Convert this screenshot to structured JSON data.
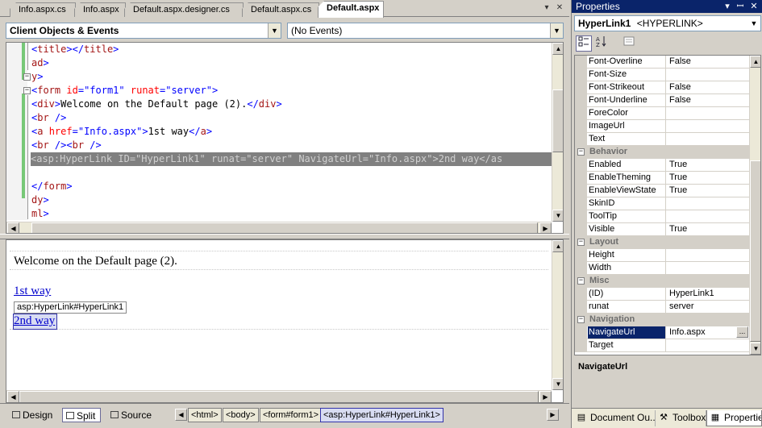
{
  "editor_tabs": [
    "Info.aspx.cs",
    "Info.aspx",
    "Default.aspx.designer.cs",
    "Default.aspx.cs",
    "Default.aspx"
  ],
  "active_tab": "Default.aspx",
  "tab_controls": {
    "dropdown": "▾",
    "close": "✕"
  },
  "client_objects_combo": "Client Objects & Events",
  "events_combo": "(No Events)",
  "code_lines": [
    "<title></title>",
    "ad>",
    "y>",
    "<form id=\"form1\" runat=\"server\">",
    "<div>Welcome on the Default page (2).</div>",
    "<br />",
    "<a href=\"Info.aspx\">1st way</a>",
    "<br /><br />",
    "<asp:HyperLink ID=\"HyperLink1\" runat=\"server\" NavigateUrl=\"Info.aspx\">2nd way</as",
    "",
    "</form>",
    "dy>",
    "ml>"
  ],
  "design": {
    "welcome_text": "Welcome on the Default page (2).",
    "link1": "1st way",
    "selected_tag": "asp:HyperLink#HyperLink1",
    "link2": "2nd way"
  },
  "view_buttons": {
    "design": "Design",
    "split": "Split",
    "source": "Source"
  },
  "breadcrumbs": [
    "<html>",
    "<body>",
    "<form#form1>",
    "<asp:HyperLink#HyperLink1>"
  ],
  "properties": {
    "title": "Properties",
    "title_buttons": {
      "dropdown": "▾",
      "pin": "ꟷ",
      "close": "✕"
    },
    "object_name": "HyperLink1",
    "object_type": "<HYPERLINK>",
    "toolbar_icons": [
      "categorized-icon",
      "alphabetical-icon",
      "property-pages-icon"
    ],
    "rows": [
      {
        "kind": "prop",
        "name": "Font-Overline",
        "value": "False"
      },
      {
        "kind": "prop",
        "name": "Font-Size",
        "value": ""
      },
      {
        "kind": "prop",
        "name": "Font-Strikeout",
        "value": "False"
      },
      {
        "kind": "prop",
        "name": "Font-Underline",
        "value": "False"
      },
      {
        "kind": "prop",
        "name": "ForeColor",
        "value": ""
      },
      {
        "kind": "prop",
        "name": "ImageUrl",
        "value": ""
      },
      {
        "kind": "prop",
        "name": "Text",
        "value": ""
      },
      {
        "kind": "cat",
        "name": "Behavior"
      },
      {
        "kind": "prop",
        "name": "Enabled",
        "value": "True"
      },
      {
        "kind": "prop",
        "name": "EnableTheming",
        "value": "True"
      },
      {
        "kind": "prop",
        "name": "EnableViewState",
        "value": "True"
      },
      {
        "kind": "prop",
        "name": "SkinID",
        "value": ""
      },
      {
        "kind": "prop",
        "name": "ToolTip",
        "value": ""
      },
      {
        "kind": "prop",
        "name": "Visible",
        "value": "True"
      },
      {
        "kind": "cat",
        "name": "Layout"
      },
      {
        "kind": "prop",
        "name": "Height",
        "value": ""
      },
      {
        "kind": "prop",
        "name": "Width",
        "value": ""
      },
      {
        "kind": "cat",
        "name": "Misc"
      },
      {
        "kind": "prop",
        "name": "(ID)",
        "value": "HyperLink1"
      },
      {
        "kind": "prop",
        "name": "runat",
        "value": "server"
      },
      {
        "kind": "cat",
        "name": "Navigation"
      },
      {
        "kind": "prop",
        "name": "NavigateUrl",
        "value": "Info.aspx",
        "selected": true
      },
      {
        "kind": "prop",
        "name": "Target",
        "value": ""
      }
    ],
    "description_title": "NavigateUrl",
    "bottom_tabs": [
      "Document Ou...",
      "Toolbox",
      "Properties"
    ],
    "ellipsis_label": "..."
  },
  "colors": {
    "selection": "#0a246a",
    "accent": "#d8dcf2",
    "link": "#0000cc",
    "changebar": "#77c877"
  }
}
